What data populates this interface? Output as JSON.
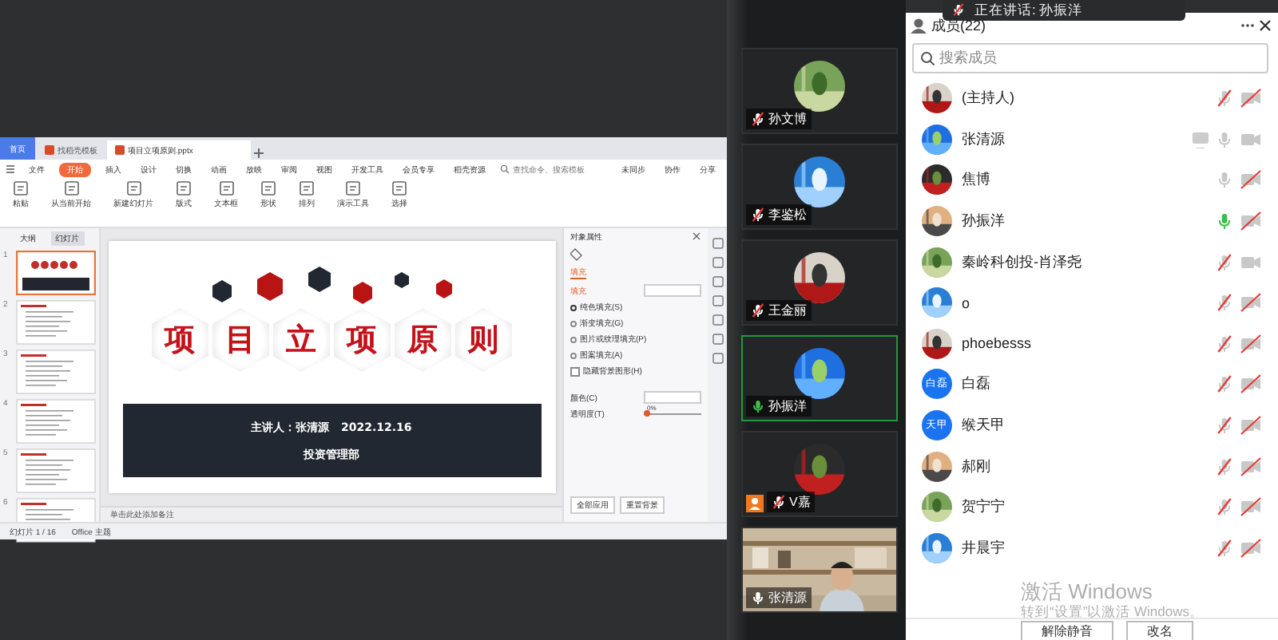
{
  "toast": {
    "text": "正在讲话: 孙振洋"
  },
  "wps": {
    "tabs": [
      {
        "label": "首页",
        "selected": false,
        "kind": "home"
      },
      {
        "label": "找稻壳模板",
        "selected": false,
        "kind": "doc"
      },
      {
        "label": "项目立项原则.pptx",
        "selected": true,
        "kind": "doc"
      }
    ],
    "menu": [
      {
        "label": "文件",
        "selected": false
      },
      {
        "label": "开始",
        "selected": true
      },
      {
        "label": "插入",
        "selected": false
      },
      {
        "label": "设计",
        "selected": false
      },
      {
        "label": "切换",
        "selected": false
      },
      {
        "label": "动画",
        "selected": false
      },
      {
        "label": "放映",
        "selected": false
      },
      {
        "label": "审阅",
        "selected": false
      },
      {
        "label": "视图",
        "selected": false
      },
      {
        "label": "开发工具",
        "selected": false
      },
      {
        "label": "会员专享",
        "selected": false
      },
      {
        "label": "稻壳资源",
        "selected": false
      }
    ],
    "search": {
      "placeholder": "查找命令、搜索模板"
    },
    "share_actions": [
      "未同步",
      "协作",
      "分享"
    ],
    "toolbar": [
      "粘贴",
      "从当前开始",
      "新建幻灯片",
      "版式",
      "文本框",
      "形状",
      "排列",
      "演示工具",
      "选择"
    ],
    "panel_tabs": [
      {
        "label": "大纲",
        "selected": false
      },
      {
        "label": "幻灯片",
        "selected": true
      }
    ],
    "thumbnails": [
      {
        "number": "1",
        "selected": true
      },
      {
        "number": "2",
        "selected": false
      },
      {
        "number": "3",
        "selected": false
      },
      {
        "number": "4",
        "selected": false
      },
      {
        "number": "5",
        "selected": false
      },
      {
        "number": "6",
        "selected": false
      }
    ],
    "slide": {
      "title_chars": [
        "项",
        "目",
        "立",
        "项",
        "原",
        "则"
      ],
      "presenter": "主讲人：张清源   2022.12.16",
      "department": "投资管理部"
    },
    "notes_placeholder": "单击此处添加备注",
    "properties": {
      "title": "对象属性",
      "tab": "填充",
      "section": "填充",
      "fill_options": [
        {
          "label": "纯色填充(S)",
          "selected": true
        },
        {
          "label": "渐变填充(G)",
          "selected": false
        },
        {
          "label": "图片或纹理填充(P)",
          "selected": false
        },
        {
          "label": "图案填充(A)",
          "selected": false
        }
      ],
      "hide_bg": {
        "label": "隐藏背景图形(H)",
        "checked": false
      },
      "color_label": "颜色(C)",
      "transparency_label": "透明度(T)",
      "transparency": {
        "level": 0,
        "reading": "0%"
      },
      "buttons": [
        "全部应用",
        "重置背景"
      ]
    },
    "status": {
      "slide": "幻灯片 1 / 16",
      "theme": "Office 主题"
    }
  },
  "tiles": [
    {
      "name": "孙文博",
      "muted": true,
      "speaking": false,
      "host": false,
      "kind": "avatar"
    },
    {
      "name": "李鉴松",
      "muted": true,
      "speaking": false,
      "host": false,
      "kind": "avatar"
    },
    {
      "name": "王金丽",
      "muted": true,
      "speaking": false,
      "host": false,
      "kind": "avatar"
    },
    {
      "name": "孙振洋",
      "muted": false,
      "speaking": true,
      "host": false,
      "kind": "avatar"
    },
    {
      "name": "V嘉",
      "muted": true,
      "speaking": false,
      "host": true,
      "kind": "avatar"
    },
    {
      "name": "张清源",
      "muted": false,
      "speaking": false,
      "host": false,
      "kind": "video"
    }
  ],
  "members_panel": {
    "title": "成员(22)",
    "search_placeholder": "搜索成员",
    "members": [
      {
        "role": "(主持人)",
        "muted": true,
        "speaking": false,
        "camera_on": false,
        "sharing": false
      },
      {
        "name": "张清源",
        "muted": false,
        "speaking": false,
        "camera_on": true,
        "sharing": true
      },
      {
        "name": "焦博",
        "muted": false,
        "speaking": false,
        "camera_on": false,
        "sharing": false
      },
      {
        "name": "孙振洋",
        "muted": false,
        "speaking": true,
        "camera_on": false,
        "sharing": false
      },
      {
        "name": "秦岭科创投-肖泽尧",
        "muted": true,
        "speaking": false,
        "camera_on": true,
        "sharing": false
      },
      {
        "name": "o",
        "muted": true,
        "speaking": false,
        "camera_on": false,
        "sharing": false
      },
      {
        "name": "phoebesss",
        "muted": true,
        "speaking": false,
        "camera_on": false,
        "sharing": false
      },
      {
        "name": "白磊",
        "avatar_text": "白磊",
        "muted": true,
        "speaking": false,
        "camera_on": false,
        "sharing": false
      },
      {
        "name": "缑天甲",
        "avatar_text": "天甲",
        "muted": true,
        "speaking": false,
        "camera_on": false,
        "sharing": false
      },
      {
        "name": "郝刚",
        "muted": true,
        "speaking": false,
        "camera_on": false,
        "sharing": false
      },
      {
        "name": "贺宁宁",
        "muted": true,
        "speaking": false,
        "camera_on": false,
        "sharing": false
      },
      {
        "name": "井晨宇",
        "muted": true,
        "speaking": false,
        "camera_on": false,
        "sharing": false
      }
    ],
    "buttons": [
      "解除静音",
      "改名"
    ]
  },
  "os_watermark": {
    "line1": "激活 Windows",
    "line2": "转到“设置”以激活 Windows。"
  }
}
